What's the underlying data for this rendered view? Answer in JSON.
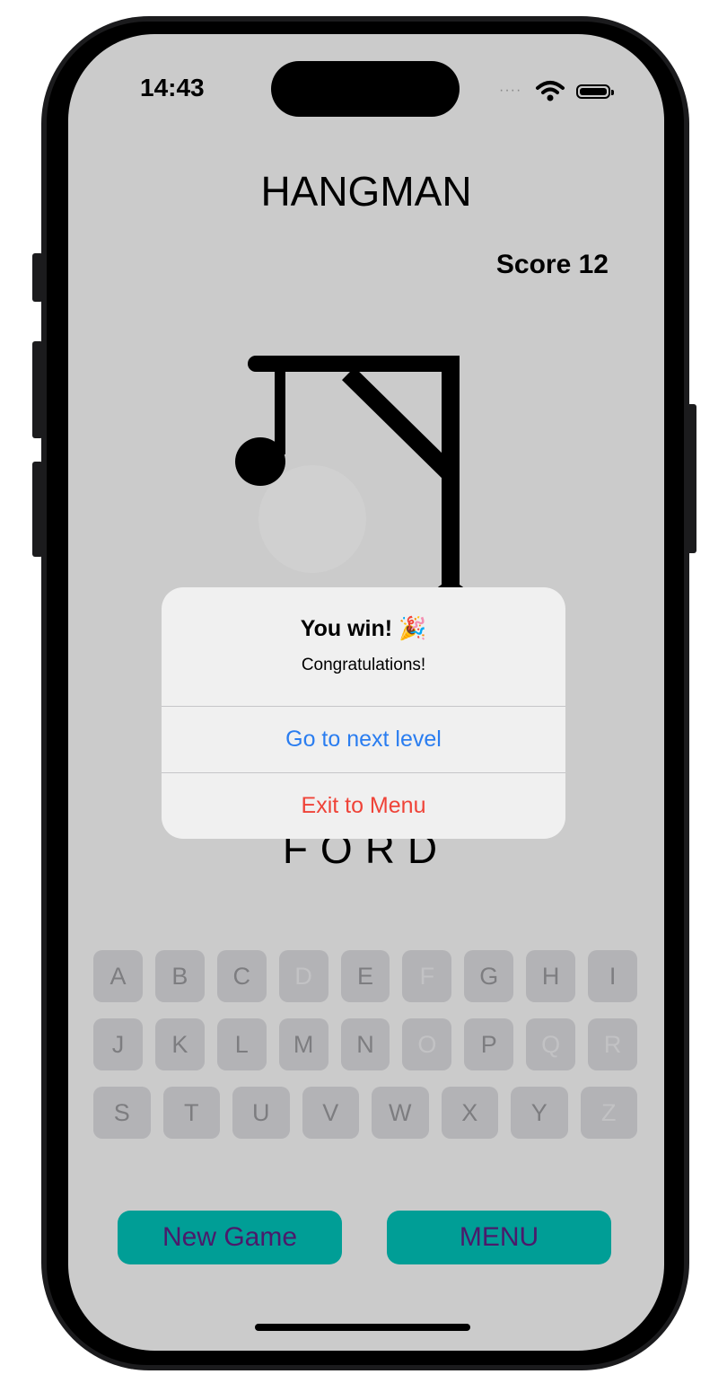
{
  "status_bar": {
    "time": "14:43",
    "signal_icon": "signal-dots-icon",
    "wifi_icon": "wifi-icon",
    "battery_icon": "battery-icon"
  },
  "app": {
    "title": "HANGMAN",
    "score_label": "Score 12"
  },
  "game": {
    "word": "FORD"
  },
  "alert": {
    "title": "You win!",
    "title_emoji": "🎉",
    "message": "Congratulations!",
    "primary_action": "Go to next level",
    "secondary_action": "Exit to Menu"
  },
  "keyboard": {
    "rows": [
      [
        {
          "letter": "A",
          "used": false
        },
        {
          "letter": "B",
          "used": false
        },
        {
          "letter": "C",
          "used": false
        },
        {
          "letter": "D",
          "used": true
        },
        {
          "letter": "E",
          "used": false
        },
        {
          "letter": "F",
          "used": true
        },
        {
          "letter": "G",
          "used": false
        },
        {
          "letter": "H",
          "used": false
        },
        {
          "letter": "I",
          "used": false
        }
      ],
      [
        {
          "letter": "J",
          "used": false
        },
        {
          "letter": "K",
          "used": false
        },
        {
          "letter": "L",
          "used": false
        },
        {
          "letter": "M",
          "used": false
        },
        {
          "letter": "N",
          "used": false
        },
        {
          "letter": "O",
          "used": true
        },
        {
          "letter": "P",
          "used": false
        },
        {
          "letter": "Q",
          "used": true
        },
        {
          "letter": "R",
          "used": true
        }
      ],
      [
        {
          "letter": "S",
          "used": false
        },
        {
          "letter": "T",
          "used": false
        },
        {
          "letter": "U",
          "used": false
        },
        {
          "letter": "V",
          "used": false
        },
        {
          "letter": "W",
          "used": false
        },
        {
          "letter": "X",
          "used": false
        },
        {
          "letter": "Y",
          "used": false
        },
        {
          "letter": "Z",
          "used": true
        }
      ]
    ]
  },
  "buttons": {
    "new_game": "New Game",
    "menu": "MENU"
  },
  "colors": {
    "screen_bg": "#cbcbcb",
    "button_bg": "#009e96",
    "button_text": "#4b1a6b",
    "alert_blue": "#2a7df0",
    "alert_red": "#ef4338"
  }
}
